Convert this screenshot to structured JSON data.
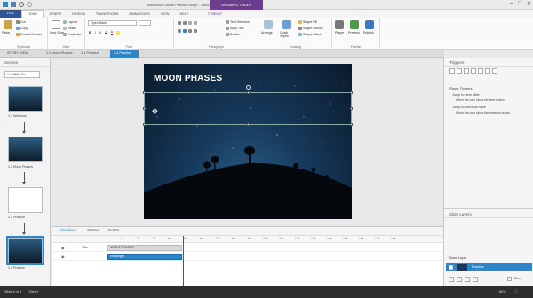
{
  "titlebar": {
    "title": "Interactive Online Practice.story* - Articulate Storyline 2",
    "context_tab": "DRAWING TOOLS",
    "win_min": "–",
    "win_max": "□",
    "win_close": "✕"
  },
  "tabs": [
    "FILE",
    "HOME",
    "INSERT",
    "DESIGN",
    "TRANSITIONS",
    "ANIMATIONS",
    "VIEW",
    "HELP",
    "FORMAT"
  ],
  "ribbon": {
    "cut": "Cut",
    "copy": "Copy",
    "paste": "Paste",
    "format_painter": "Format Painter",
    "clipboard_label": "Clipboard",
    "new_slide": "New Slide",
    "layout": "Layout",
    "reset": "Reset",
    "duplicate": "Duplicate",
    "slide_label": "Slide",
    "font_name": "Open Sans",
    "font_size": "",
    "font_label": "Font",
    "bold": "B",
    "italic": "I",
    "underline": "U",
    "strike": "S",
    "font_color": "A",
    "paragraph_label": "Paragraph",
    "text_direction": "Text Direction",
    "align_text": "Align Text",
    "bullets_label": "Bullets",
    "arrange": "Arrange",
    "quick_styles": "Quick Styles",
    "shape_fill": "Shape Fill",
    "shape_outline": "Shape Outline",
    "shape_effect": "Shape Effect",
    "drawing_label": "Drawing",
    "player": "Player",
    "preview": "Preview",
    "publish": "Publish",
    "publish_label": "Publish"
  },
  "doctabs": [
    "STORY VIEW",
    "1.2 Moon Phases",
    "1.3 Practice",
    "2.4 Practice"
  ],
  "scenes": {
    "header": "Scenes",
    "selector": "1 Untitled Sc",
    "slides": [
      "1.1 Welcome",
      "1.2 Moon Phases",
      "1.3 Practice",
      "1.4 Practice"
    ]
  },
  "slide": {
    "title": "MOON PHASES"
  },
  "timeline": {
    "tabs": [
      "Timeline",
      "States",
      "Notes"
    ],
    "ticks": [
      "1s",
      "2s",
      "3s",
      "4s",
      "5s",
      "6s",
      "7s",
      "8s",
      "9s",
      "10s",
      "11s",
      "12s",
      "13s",
      "14s",
      "15s",
      "16s",
      "17s",
      "18s"
    ],
    "rows": [
      {
        "name": "Title",
        "bar": "MOON PHASES"
      },
      {
        "name": "",
        "bar": "Rectangle"
      }
    ]
  },
  "right": {
    "triggers_header": "Triggers",
    "player_triggers": "Player Triggers",
    "jump_next": "Jump to next slide",
    "when_next": "When the user clicks the next button",
    "jump_prev": "Jump to previous slide",
    "when_prev": "When the user clicks the previous button",
    "layers_header": "Slide Layers",
    "base_layer": "Base Layer",
    "practice_layer": "Practice",
    "dim": "Dim"
  },
  "status": {
    "slide_info": "Slide 4 of 4",
    "theme": "'Clean'",
    "zoom": "60%"
  },
  "colors": {
    "accent": "#2e86c9",
    "file_tab": "#2b579a",
    "context": "#6b3d8f"
  }
}
